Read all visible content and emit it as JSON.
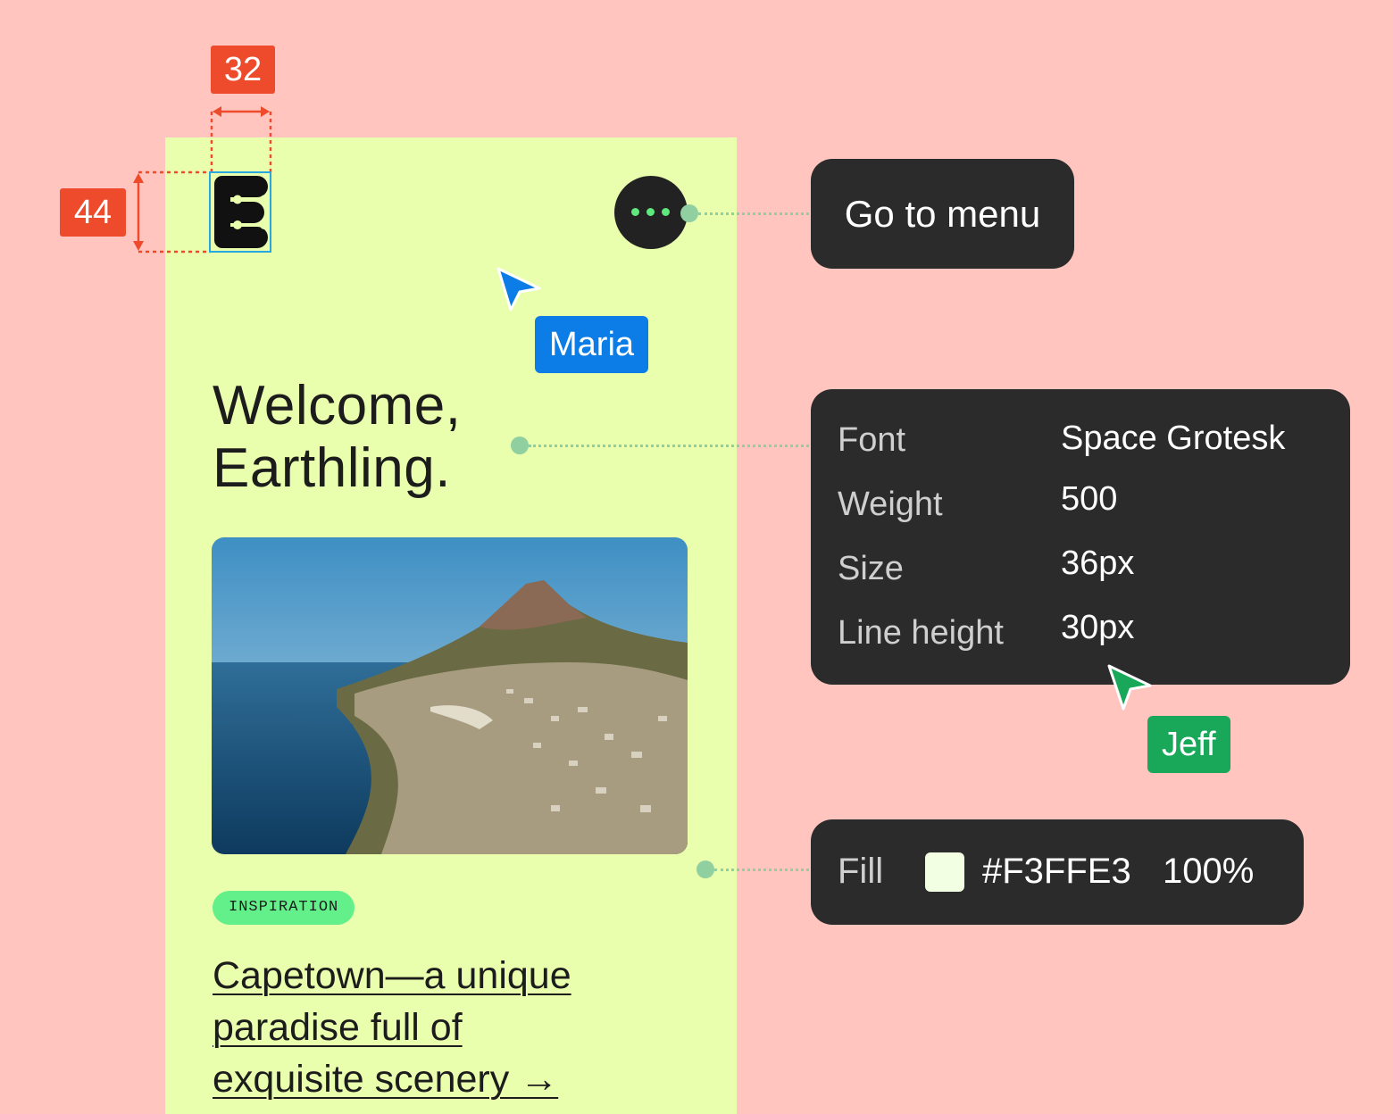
{
  "measurements": {
    "width_label": "32",
    "height_label": "44"
  },
  "header": {
    "menu_tooltip": "Go to menu"
  },
  "content": {
    "headline_line1": "Welcome,",
    "headline_line2": "Earthling.",
    "tag": "INSPIRATION",
    "article_line1": "Capetown—a unique",
    "article_line2": "paradise full of",
    "article_line3": "exquisite scenery →"
  },
  "font_panel": {
    "rows": [
      {
        "key": "Font",
        "value": "Space Grotesk"
      },
      {
        "key": "Weight",
        "value": "500"
      },
      {
        "key": "Size",
        "value": "36px"
      },
      {
        "key": "Line height",
        "value": "30px"
      }
    ]
  },
  "fill_panel": {
    "label": "Fill",
    "hex": "#F3FFE3",
    "opacity": "100%"
  },
  "cursors": [
    {
      "name": "Maria",
      "color": "#0C7CE6"
    },
    {
      "name": "Jeff",
      "color": "#19A85A"
    }
  ],
  "colors": {
    "background": "#FFC5BE",
    "frame": "#EAFFAE",
    "accent": "#EE4A2C",
    "panel": "#2B2B2B"
  }
}
